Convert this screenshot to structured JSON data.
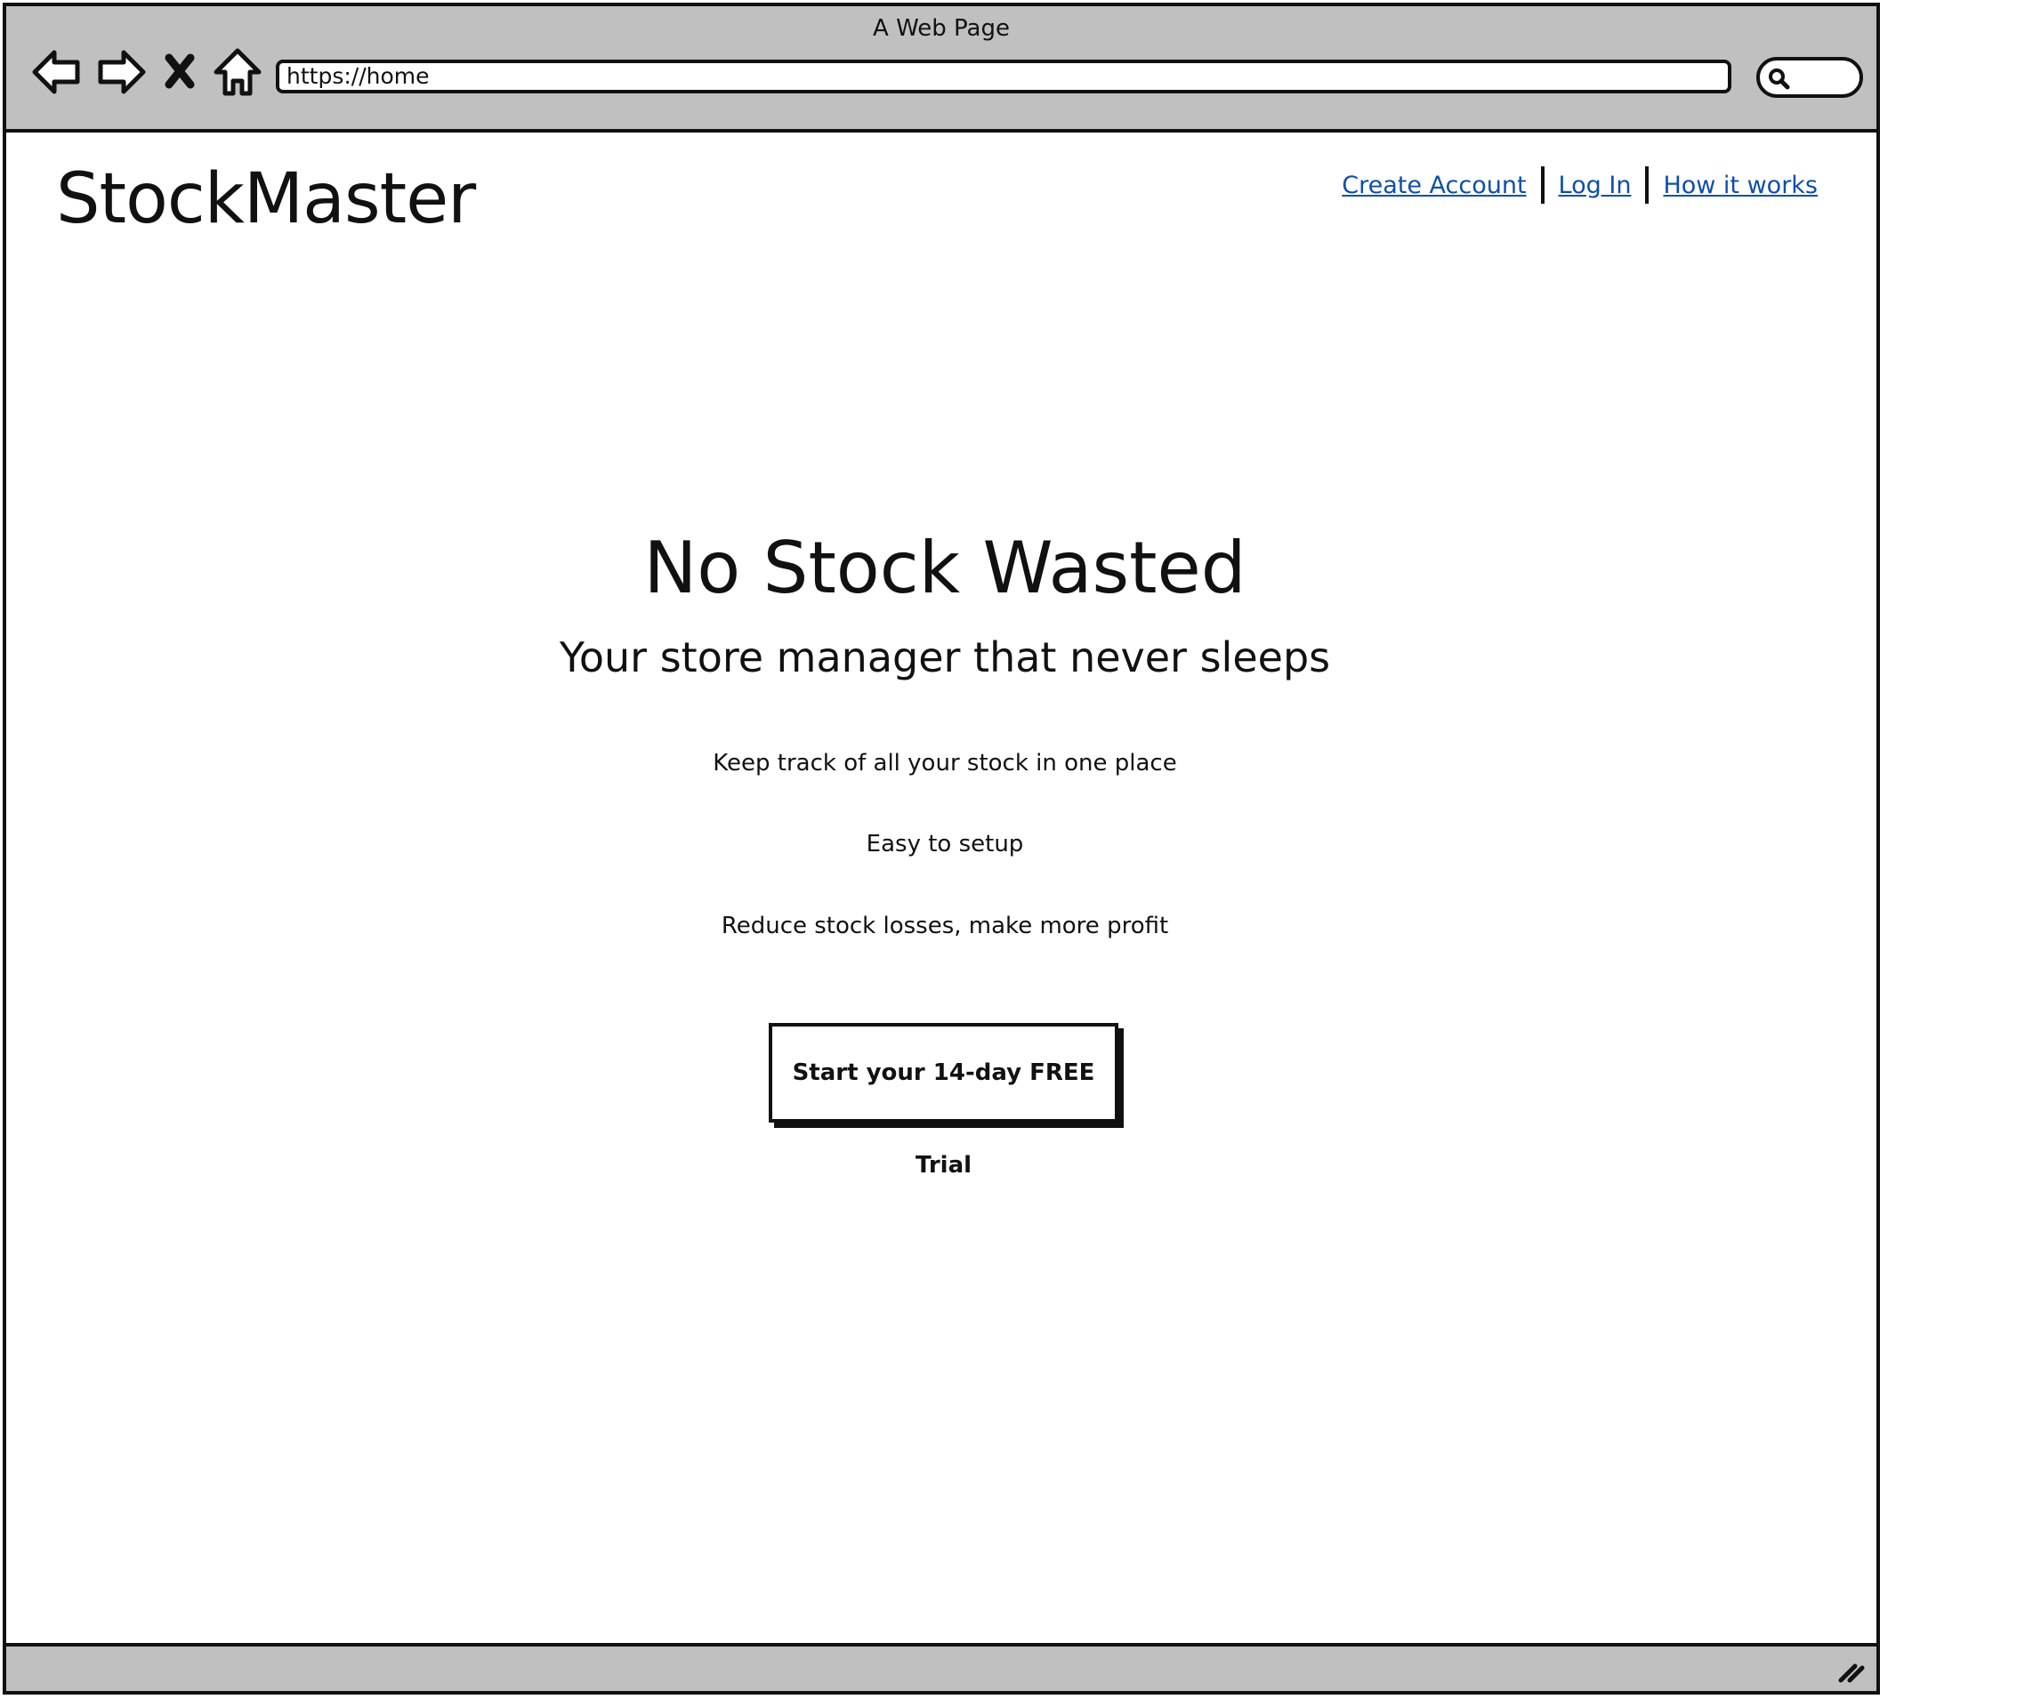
{
  "browser": {
    "window_title": "A Web Page",
    "url": "https://home",
    "icons": [
      "back-arrow-icon",
      "forward-arrow-icon",
      "stop-icon",
      "home-icon",
      "search-icon",
      "resize-grip-icon"
    ]
  },
  "header": {
    "logo": "StockMaster",
    "links": {
      "create_account": "Create Account",
      "log_in": "Log In",
      "how_it_works": "How it works"
    },
    "link_color": "#0f4fa8"
  },
  "hero": {
    "title": "No Stock Wasted",
    "subtitle": "Your store manager that never sleeps",
    "features": [
      "Keep track of all your stock in one place",
      "Easy to setup",
      "Reduce stock losses, make more profit"
    ],
    "cta_label": "Start your 14-day FREE Trial"
  },
  "colors": {
    "chrome": "#c0c0c0",
    "border": "#111111",
    "background": "#ffffff"
  }
}
